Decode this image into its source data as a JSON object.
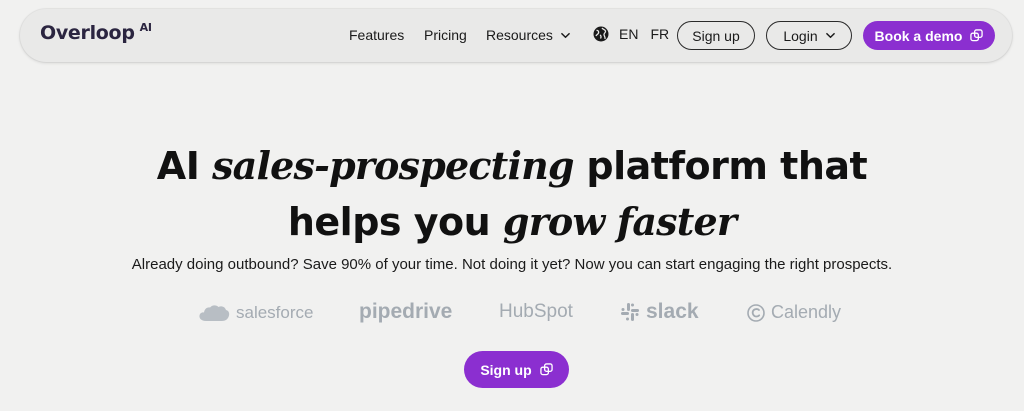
{
  "brand": {
    "name": "Overloop",
    "suffix": "AI"
  },
  "nav": {
    "features": "Features",
    "pricing": "Pricing",
    "resources": "Resources",
    "lang_en": "EN",
    "lang_fr": "FR",
    "signup": "Sign up",
    "login": "Login",
    "book_demo": "Book a demo"
  },
  "hero": {
    "line1_a": "AI ",
    "line1_em": "sales-prospecting",
    "line1_b": " platform that",
    "line2_a": "helps you ",
    "line2_em": "grow faster",
    "subtitle": "Already doing outbound? Save 90% of your time. Not doing it yet? Now you can start engaging the right prospects.",
    "cta": "Sign up"
  },
  "logos": {
    "salesforce": "salesforce",
    "pipedrive": "pipedrive",
    "hubspot": "HubSpot",
    "slack": "slack",
    "calendly": "Calendly"
  },
  "colors": {
    "accent": "#8b2fd0",
    "background": "#f1f1f0",
    "logo_gray": "#a4abb2"
  },
  "icons": [
    "chevron-down-icon",
    "globe-icon",
    "external-link-icon",
    "cloud-icon",
    "slack-icon",
    "calendly-icon"
  ]
}
